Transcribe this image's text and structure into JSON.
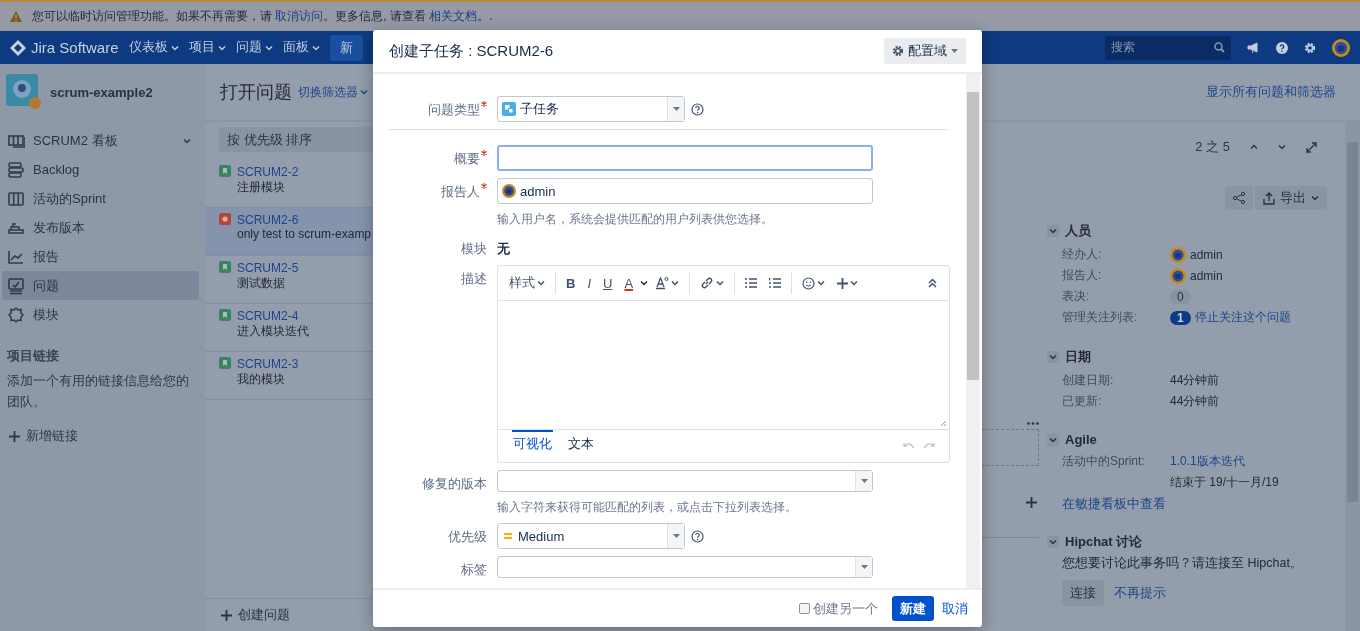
{
  "banner": {
    "segments": [
      {
        "kind": "text",
        "text": "您可以临时访问管理功能。如果不再需要，请 "
      },
      {
        "kind": "link",
        "text": "取消访问"
      },
      {
        "kind": "text",
        "text": "。更多信息, 请查看 "
      },
      {
        "kind": "link",
        "text": "相关文档"
      },
      {
        "kind": "text",
        "text": "。."
      }
    ]
  },
  "header": {
    "logo": "Jira Software",
    "menus": [
      "仪表板",
      "项目",
      "问题",
      "面板"
    ],
    "create": "新",
    "search": {
      "placeholder": "搜索"
    }
  },
  "sidebar": {
    "project": "scrum-example2",
    "items": [
      {
        "label": "SCRUM2 看板",
        "expandable": true,
        "selected": false
      },
      {
        "label": "Backlog",
        "expandable": false,
        "selected": false
      },
      {
        "label": "活动的Sprint",
        "expandable": false,
        "selected": false
      },
      {
        "label": "发布版本",
        "expandable": false,
        "selected": false
      },
      {
        "label": "报告",
        "expandable": false,
        "selected": false
      },
      {
        "label": "问题",
        "expandable": false,
        "selected": true
      },
      {
        "label": "模块",
        "expandable": false,
        "selected": false
      }
    ],
    "links_title": "项目链接",
    "links_text": "添加一个有用的链接信息给您的团队。",
    "add_link": "新增链接"
  },
  "issues": {
    "title": "打开问题",
    "switch_filter": "切换筛选器",
    "sort": "按 优先级 排序",
    "items": [
      {
        "key": "SCRUM2-2",
        "summary": "注册模块",
        "kind": "story",
        "selected": false
      },
      {
        "key": "SCRUM2-6",
        "summary": "only test to scrum-examp",
        "kind": "bug",
        "selected": true
      },
      {
        "key": "SCRUM2-5",
        "summary": "测试数据",
        "kind": "story",
        "selected": false
      },
      {
        "key": "SCRUM2-4",
        "summary": "进入模块迭代",
        "kind": "story",
        "selected": false
      },
      {
        "key": "SCRUM2-3",
        "summary": "我的模块",
        "kind": "story",
        "selected": false
      }
    ],
    "create": "创建问题"
  },
  "show_all": "显示所有问题和筛选器",
  "detail": {
    "pager": "2 之 5",
    "export": "导出",
    "sections": [
      {
        "title": "人员",
        "rows": [
          {
            "label": "经办人:",
            "kind": "user",
            "value": "admin"
          },
          {
            "label": "报告人:",
            "kind": "user",
            "value": "admin"
          },
          {
            "label": "表决:",
            "kind": "count",
            "value": "0"
          },
          {
            "label": "管理关注列表:",
            "kind": "watch",
            "value": "1",
            "link": "停止关注这个问题"
          }
        ]
      },
      {
        "title": "日期",
        "rows": [
          {
            "label": "创建日期:",
            "kind": "text",
            "value": "44分钟前"
          },
          {
            "label": "已更新:",
            "kind": "text",
            "value": "44分钟前"
          }
        ]
      },
      {
        "title": "Agile",
        "rows": [
          {
            "label": "活动中的Sprint:",
            "kind": "sprint",
            "value": "1.0.1版本迭代",
            "note": "结束于 19/十一月/19"
          }
        ],
        "link": "在敏捷看板中查看"
      },
      {
        "title": "Hipchat 讨论",
        "text": "您想要讨论此事务吗？请连接至 Hipchat。",
        "button": "连接",
        "link": "不再提示"
      }
    ]
  },
  "modal": {
    "title": "创建子任务 : SCRUM2-6",
    "config": "配置域",
    "fields": [
      {
        "kind": "issuetype",
        "label": "问题类型",
        "required": true,
        "value": "子任务",
        "help": true
      },
      {
        "kind": "divider"
      },
      {
        "kind": "text",
        "label": "概要",
        "required": true,
        "focused": true
      },
      {
        "kind": "user",
        "label": "报告人",
        "required": true,
        "value": "admin",
        "hint": "输入用户名，系统会提供匹配的用户列表供您选择。"
      },
      {
        "kind": "static",
        "label": "模块",
        "required": false,
        "value": "无"
      },
      {
        "kind": "editor",
        "label": "描述",
        "required": false,
        "style_menu": "样式",
        "format": [
          {
            "kind": "bold",
            "label": "B"
          },
          {
            "kind": "italic",
            "label": "I"
          },
          {
            "kind": "underline",
            "label": "U"
          },
          {
            "kind": "color",
            "label": "A"
          }
        ],
        "tabs": [
          {
            "label": "可视化",
            "selected": true
          },
          {
            "label": "文本",
            "selected": false
          }
        ]
      },
      {
        "kind": "multiselect",
        "label": "修复的版本",
        "required": false,
        "hint": "输入字符来获得可能匹配的列表，或点击下拉列表选择。"
      },
      {
        "kind": "priority",
        "label": "优先级",
        "required": false,
        "value": "Medium",
        "help": true
      },
      {
        "kind": "multiselect",
        "label": "标签",
        "required": false
      }
    ],
    "create_another": {
      "label": "创建另一个",
      "checked": false
    },
    "submit": "新建",
    "cancel": "取消"
  }
}
